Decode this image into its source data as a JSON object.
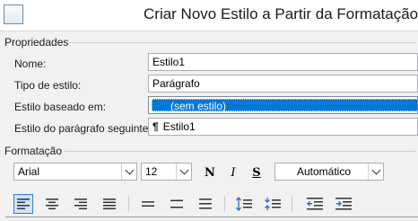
{
  "window": {
    "title": "Criar Novo Estilo a Partir da Formatação"
  },
  "properties": {
    "heading": "Propriedades",
    "name_label": "Nome:",
    "name_value": "Estilo1",
    "type_label": "Tipo de estilo:",
    "type_value": "Parágrafo",
    "based_on_label": "Estilo baseado em:",
    "based_on_value": "(sem estilo)",
    "next_label": "Estilo do parágrafo seguinte:",
    "next_value": "Estilo1",
    "next_glyph": "¶"
  },
  "formatting": {
    "heading": "Formatação",
    "font": "Arial",
    "size": "12",
    "bold_glyph": "N",
    "italic_glyph": "I",
    "underline_glyph": "S",
    "color": "Automático"
  },
  "icons": {
    "align": [
      "align-left-icon",
      "align-center-icon",
      "align-right-icon",
      "justify-icon"
    ],
    "spacing": [
      "single-spacing-icon",
      "one-half-spacing-icon",
      "double-spacing-icon"
    ],
    "para_spacing": [
      "increase-paragraph-spacing-icon",
      "decrease-paragraph-spacing-icon"
    ],
    "indent": [
      "decrease-indent-icon",
      "increase-indent-icon"
    ]
  },
  "colors": {
    "selection": "#0078d7",
    "active_button": "#cde3f8",
    "active_border": "#3d7bc4",
    "arrow_blue": "#2b6cc4"
  }
}
